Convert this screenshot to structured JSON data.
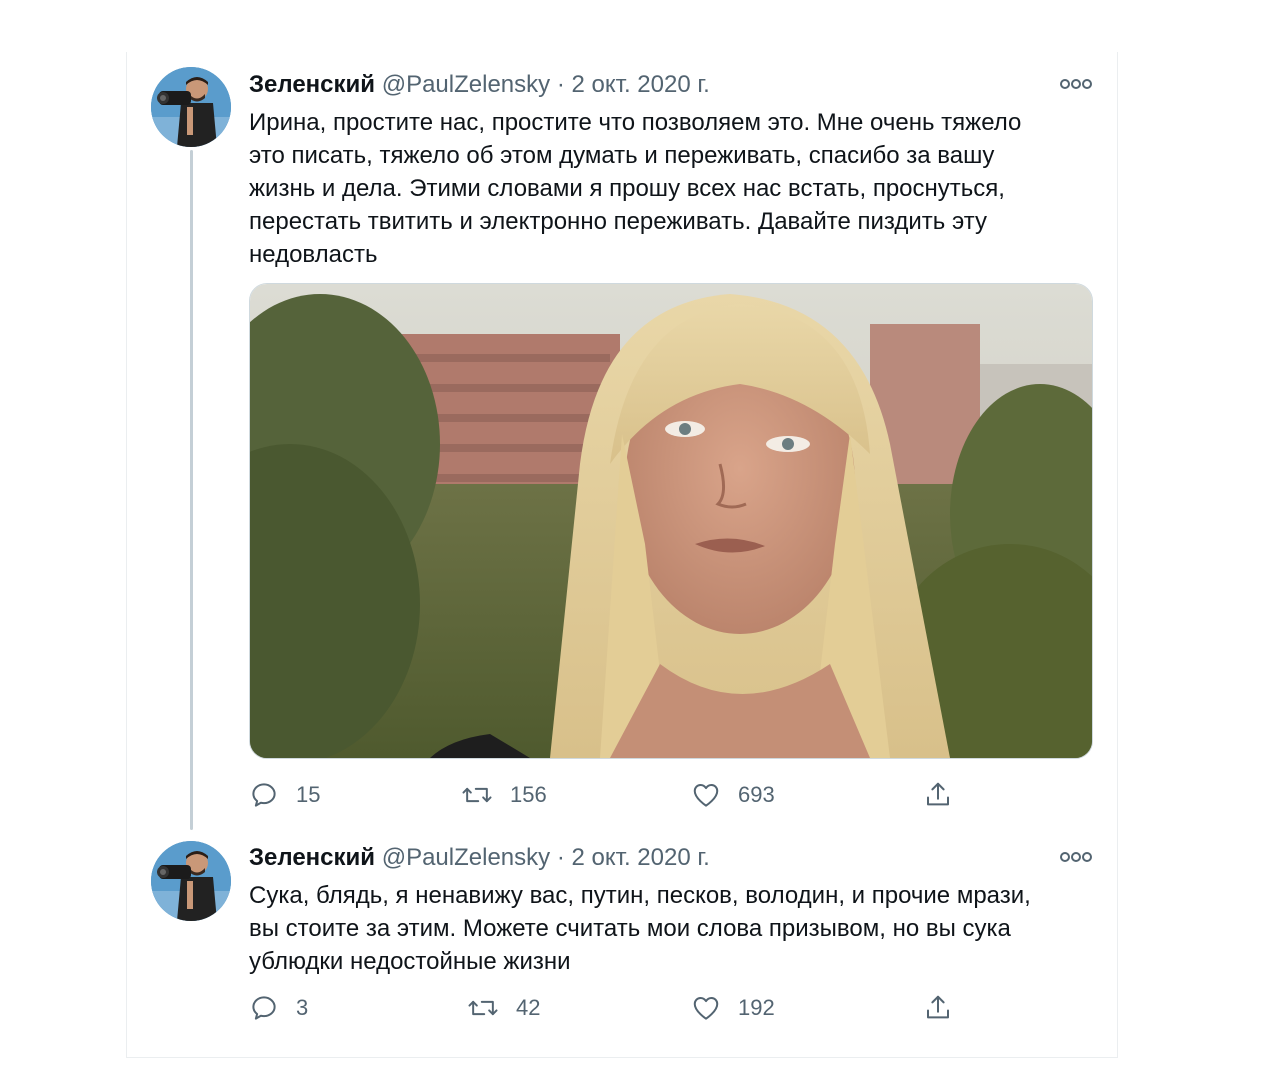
{
  "thread": {
    "tweets": [
      {
        "author_name": "Зеленский",
        "author_handle": "@PaulZelensky",
        "separator": "·",
        "date": "2 окт. 2020 г.",
        "text": "Ирина, простите нас, простите что позволяем это. Мне очень тяжело\nэто писать, тяжело об этом думать и переживать, спасибо за вашу\nжизнь и дела. Этими словами я прошу всех нас встать, проснуться,\nперестать твитить и электронно переживать. Давайте пиздить эту\nнедовласть",
        "has_photo": true,
        "photo_description_icon": "photo-of-woman-icon",
        "replies": "15",
        "retweets": "156",
        "likes": "693"
      },
      {
        "author_name": "Зеленский",
        "author_handle": "@PaulZelensky",
        "separator": "·",
        "date": "2 окт. 2020 г.",
        "text": "Сука, блядь, я ненавижу вас, путин, песков, володин, и прочие мрази,\nвы стоите за этим. Можете считать мои слова призывом, но вы сука\nублюдки недостойные жизни",
        "has_photo": false,
        "replies": "3",
        "retweets": "42",
        "likes": "192"
      }
    ]
  },
  "icons": {
    "reply": "reply-icon",
    "retweet": "retweet-icon",
    "like": "like-icon",
    "share": "share-icon",
    "more": "more-icon"
  },
  "colors": {
    "text_primary": "#0f1419",
    "text_secondary": "#536471",
    "thread_line": "#c4cfd6",
    "border": "#ebeef0"
  }
}
